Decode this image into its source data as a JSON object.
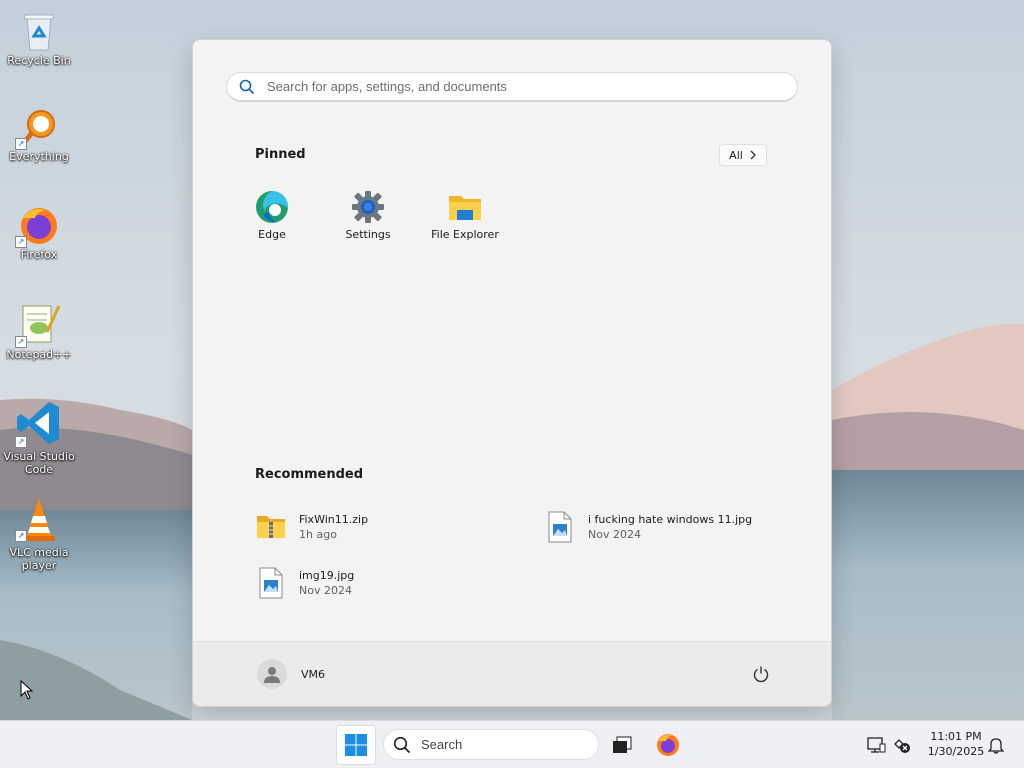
{
  "desktop": {
    "icons": [
      {
        "label": "Recycle Bin",
        "icon": "recycle-bin-icon"
      },
      {
        "label": "Everything",
        "icon": "everything-search-icon"
      },
      {
        "label": "Firefox",
        "icon": "firefox-icon"
      },
      {
        "label": "Notepad++",
        "icon": "notepad-plus-plus-icon"
      },
      {
        "label": "Visual Studio Code",
        "icon": "vscode-icon"
      },
      {
        "label": "VLC media player",
        "icon": "vlc-icon"
      }
    ]
  },
  "start_menu": {
    "search_placeholder": "Search for apps, settings, and documents",
    "pinned_title": "Pinned",
    "all_button": "All",
    "pinned": [
      {
        "label": "Edge",
        "icon": "edge-icon"
      },
      {
        "label": "Settings",
        "icon": "settings-gear-icon"
      },
      {
        "label": "File Explorer",
        "icon": "folder-icon"
      }
    ],
    "recommended_title": "Recommended",
    "recommended": [
      {
        "name": "FixWin11.zip",
        "time": "1h ago",
        "icon": "zip-folder-icon"
      },
      {
        "name": "i fucking hate windows 11.jpg",
        "time": "Nov 2024",
        "icon": "image-file-icon"
      },
      {
        "name": "img19.jpg",
        "time": "Nov 2024",
        "icon": "image-file-icon"
      }
    ],
    "user": {
      "name": "VM6"
    }
  },
  "taskbar": {
    "search_label": "Search",
    "clock": {
      "time": "11:01 PM",
      "date": "1/30/2025"
    }
  },
  "colors": {
    "accent": "#0078d4",
    "menu_bg": "#f3f3f3",
    "taskbar_bg": "#eef0f3"
  }
}
